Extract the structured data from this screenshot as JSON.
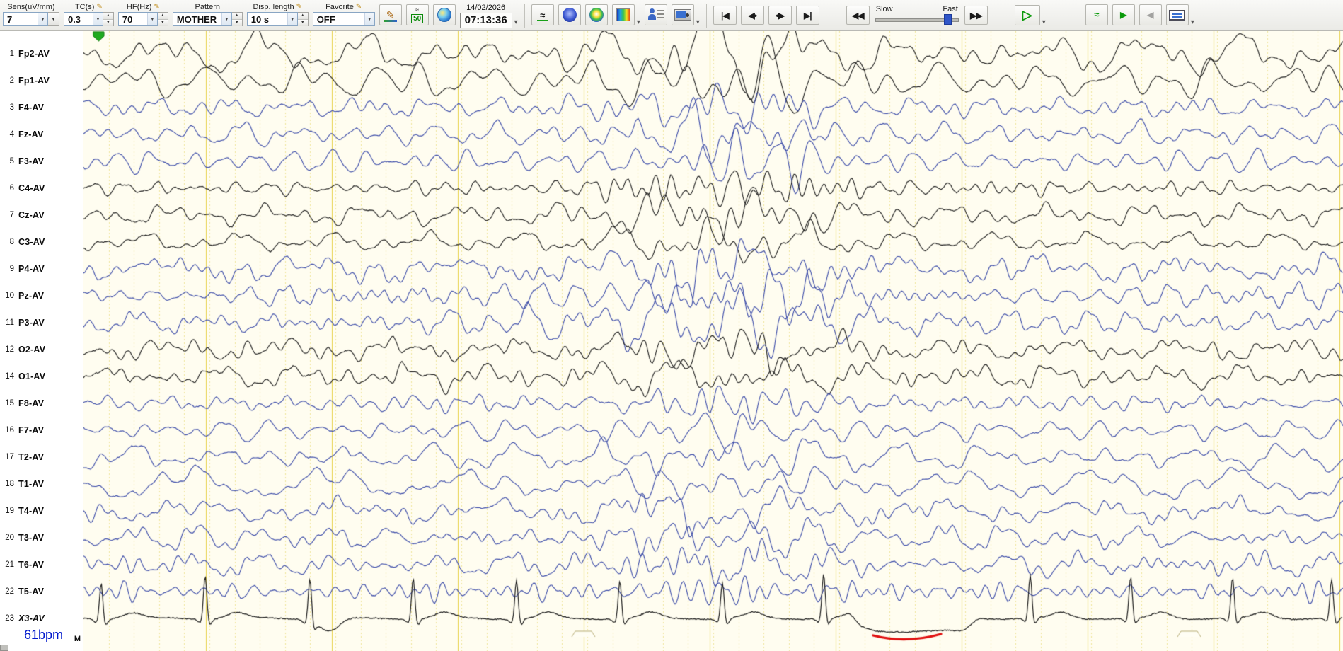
{
  "toolbar": {
    "sens": {
      "label": "Sens(uV/mm)",
      "value": "7"
    },
    "tc": {
      "label": "TC(s)",
      "value": "0.3"
    },
    "hf": {
      "label": "HF(Hz)",
      "value": "70"
    },
    "pattern": {
      "label": "Pattern",
      "value": "MOTHER"
    },
    "disp_length": {
      "label": "Disp. length",
      "value": "10 s"
    },
    "favorite": {
      "label": "Favorite",
      "value": "OFF"
    },
    "datetime": {
      "date": "14/02/2026",
      "time": "07:13:36"
    },
    "speed": {
      "slow_label": "Slow",
      "fast_label": "Fast"
    }
  },
  "icons": {
    "pencil": "✎",
    "combo_arrow": "▼",
    "spin_up": "▲",
    "spin_down": "▼",
    "caret": "▾",
    "skip_start": "|◀",
    "step_back": "◀•",
    "step_forward": "•▶",
    "skip_end": "▶|",
    "rewind": "◀◀",
    "fast_forward": "▶▶",
    "play": "▷",
    "play_small": "▶",
    "back_arrow": "◀",
    "wave": "≈",
    "notch_50": "50"
  },
  "channels": [
    {
      "num": "1",
      "label": "Fp2-AV",
      "color": "black"
    },
    {
      "num": "2",
      "label": "Fp1-AV",
      "color": "black"
    },
    {
      "num": "3",
      "label": "F4-AV",
      "color": "blue"
    },
    {
      "num": "4",
      "label": "Fz-AV",
      "color": "blue"
    },
    {
      "num": "5",
      "label": "F3-AV",
      "color": "blue"
    },
    {
      "num": "6",
      "label": "C4-AV",
      "color": "black"
    },
    {
      "num": "7",
      "label": "Cz-AV",
      "color": "black"
    },
    {
      "num": "8",
      "label": "C3-AV",
      "color": "black"
    },
    {
      "num": "9",
      "label": "P4-AV",
      "color": "blue"
    },
    {
      "num": "10",
      "label": "Pz-AV",
      "color": "blue"
    },
    {
      "num": "11",
      "label": "P3-AV",
      "color": "blue"
    },
    {
      "num": "12",
      "label": "O2-AV",
      "color": "black"
    },
    {
      "num": "14",
      "label": "O1-AV",
      "color": "black"
    },
    {
      "num": "15",
      "label": "F8-AV",
      "color": "blue"
    },
    {
      "num": "16",
      "label": "F7-AV",
      "color": "blue"
    },
    {
      "num": "17",
      "label": "T2-AV",
      "color": "blue"
    },
    {
      "num": "18",
      "label": "T1-AV",
      "color": "blue"
    },
    {
      "num": "19",
      "label": "T4-AV",
      "color": "blue"
    },
    {
      "num": "20",
      "label": "T3-AV",
      "color": "blue"
    },
    {
      "num": "21",
      "label": "T6-AV",
      "color": "blue"
    },
    {
      "num": "22",
      "label": "T5-AV",
      "color": "blue"
    },
    {
      "num": "23",
      "label": "X3-AV",
      "color": "black",
      "italic": true
    }
  ],
  "ecg": {
    "bpm": "61bpm"
  },
  "labels": {
    "marker": "M"
  },
  "colors": {
    "paper": "#fffdf0",
    "grid_major": "#e8d24a",
    "grid_minor": "#f0e59a",
    "trace_black": "#1a1a1a",
    "trace_blue": "#3a4aa8",
    "ecg_red_mark": "#e01010",
    "event_green": "#1faa1f"
  }
}
